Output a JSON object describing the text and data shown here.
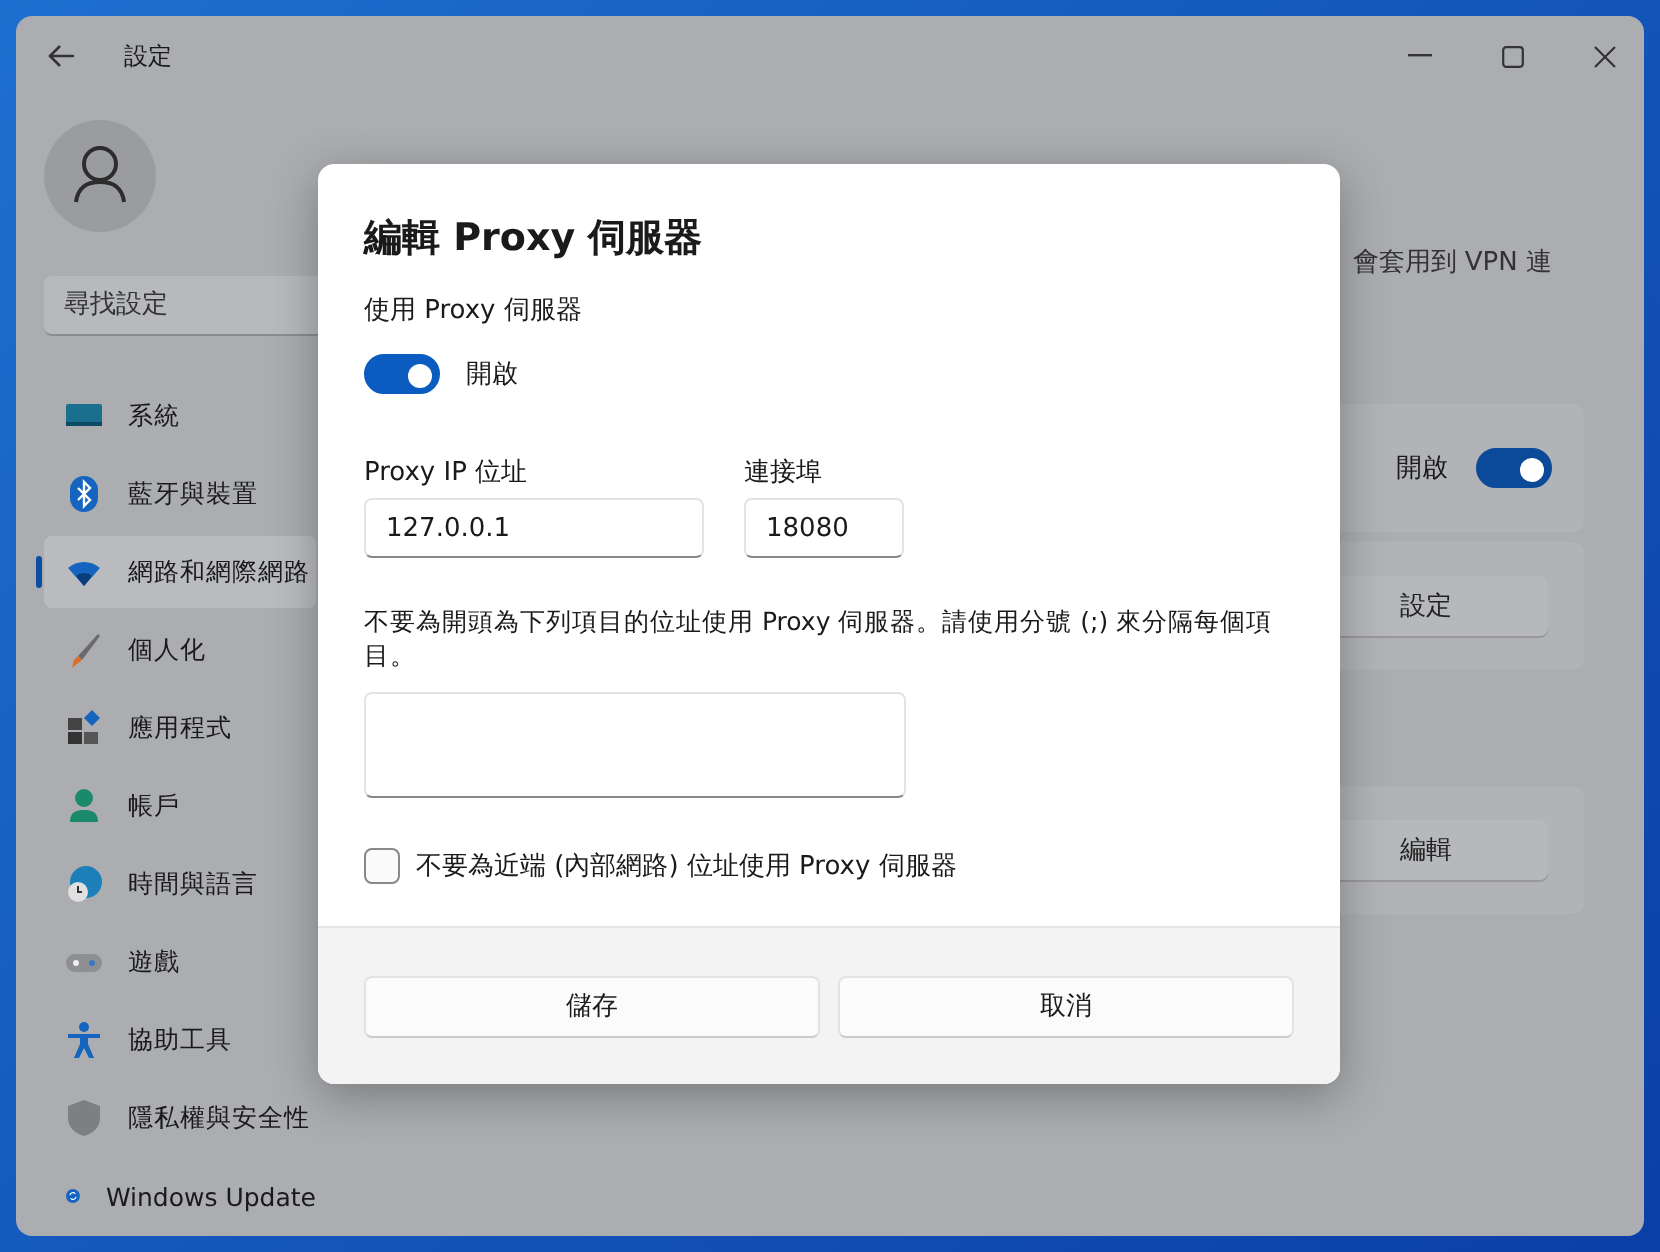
{
  "window": {
    "title": "設定"
  },
  "sidebar": {
    "search": {
      "placeholder": "尋找設定"
    },
    "items": [
      {
        "label": "系統",
        "selected": false
      },
      {
        "label": "藍牙與裝置",
        "selected": false
      },
      {
        "label": "網路和網際網路",
        "selected": true
      },
      {
        "label": "個人化",
        "selected": false
      },
      {
        "label": "應用程式",
        "selected": false
      },
      {
        "label": "帳戶",
        "selected": false
      },
      {
        "label": "時間與語言",
        "selected": false
      },
      {
        "label": "遊戲",
        "selected": false
      },
      {
        "label": "協助工具",
        "selected": false
      },
      {
        "label": "隱私權與安全性",
        "selected": false
      },
      {
        "label": "Windows Update",
        "selected": false
      }
    ]
  },
  "background": {
    "description_tail": "會套用到 VPN 連",
    "auto_setting": {
      "state_text": "開啟",
      "on": true
    },
    "setup_button": "設定",
    "edit_button": "編輯"
  },
  "dialog": {
    "title": "編輯 Proxy 伺服器",
    "use_proxy": {
      "label": "使用 Proxy 伺服器",
      "on": true,
      "state_text": "開啟"
    },
    "ip": {
      "label": "Proxy IP 位址",
      "value": "127.0.0.1"
    },
    "port": {
      "label": "連接埠",
      "value": "18080"
    },
    "exceptions": {
      "label": "不要為開頭為下列項目的位址使用 Proxy 伺服器。請使用分號 (;) 來分隔每個項目。"
    },
    "local_bypass": {
      "label": "不要為近端 (內部網路) 位址使用 Proxy 伺服器",
      "checked": false
    },
    "buttons": [
      "儲存",
      "取消"
    ]
  }
}
